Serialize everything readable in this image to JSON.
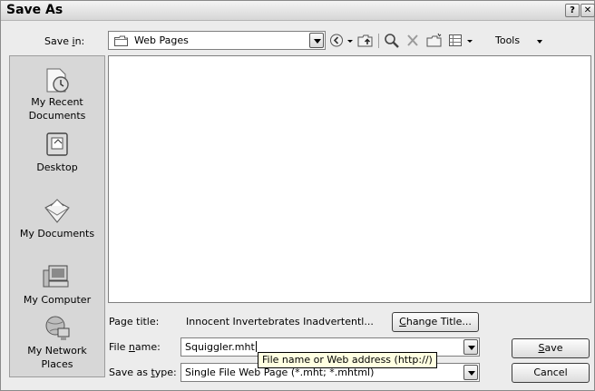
{
  "window": {
    "title": "Save As",
    "help_glyph": "?",
    "close_glyph": "✕"
  },
  "save_in": {
    "label_pre": "Save ",
    "label_key": "i",
    "label_post": "n:",
    "value": "Web Pages"
  },
  "toolbar": {
    "tools_label": "Tools",
    "tools_key": "l",
    "icons": [
      "back-icon",
      "up-folder-icon",
      "search-web-icon",
      "delete-icon",
      "new-folder-icon",
      "views-icon"
    ]
  },
  "places": [
    {
      "label_1": "My Recent",
      "label_2": "Documents",
      "icon": "recent-documents-icon"
    },
    {
      "label_1": "Desktop",
      "label_2": "",
      "icon": "desktop-icon"
    },
    {
      "label_1": "My Documents",
      "label_2": "",
      "icon": "my-documents-icon"
    },
    {
      "label_1": "My Computer",
      "label_2": "",
      "icon": "my-computer-icon"
    },
    {
      "label_1": "My Network",
      "label_2": "Places",
      "icon": "my-network-icon"
    }
  ],
  "page_title": {
    "label": "Page title:",
    "value": "Innocent Invertebrates Inadvertentl...",
    "change_button_pre": "",
    "change_button_key": "C",
    "change_button_post": "hange Title..."
  },
  "file_name": {
    "label_pre": "File ",
    "label_key": "n",
    "label_post": "ame:",
    "value": "Squiggler.mht"
  },
  "save_as_type": {
    "label_pre": "Save as ",
    "label_key": "t",
    "label_post": "ype:",
    "value": "Single File Web Page (*.mht; *.mhtml)"
  },
  "tooltip": "File name or Web address (http://)",
  "buttons": {
    "save_key": "S",
    "save_rest": "ave",
    "cancel": "Cancel"
  }
}
